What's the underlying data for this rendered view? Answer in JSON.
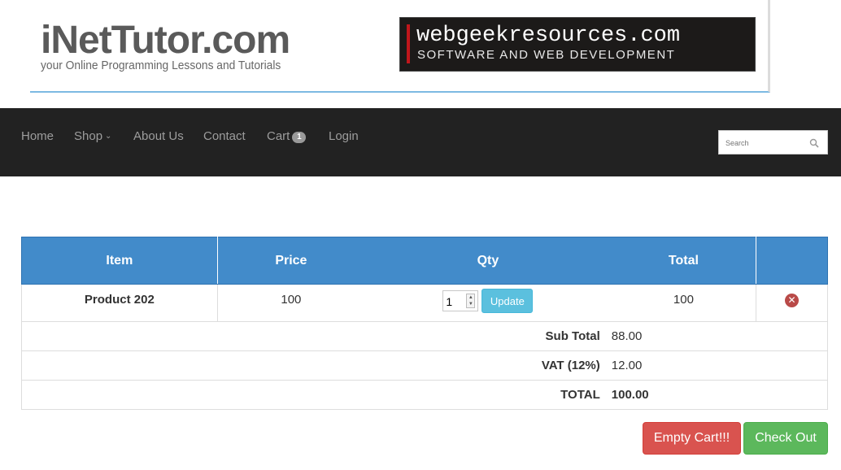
{
  "banner": {
    "logo_title": "iNetTutor.com",
    "logo_subtitle": "your Online Programming Lessons and Tutorials",
    "ad_line1": "webgeekresources.com",
    "ad_line2": "SOFTWARE AND WEB DEVELOPMENT"
  },
  "nav": {
    "home": "Home",
    "shop": "Shop",
    "about": "About Us",
    "contact": "Contact",
    "cart": "Cart",
    "cart_count": "1",
    "login": "Login",
    "search_placeholder": "Search"
  },
  "cart": {
    "headers": {
      "item": "Item",
      "price": "Price",
      "qty": "Qty",
      "total": "Total"
    },
    "rows": [
      {
        "item": "Product 202",
        "price": "100",
        "qty": "1",
        "total": "100"
      }
    ],
    "update_label": "Update",
    "subtotal_label": "Sub Total",
    "subtotal_value": "88.00",
    "vat_label": "VAT (12%)",
    "vat_value": "12.00",
    "total_label": "TOTAL",
    "total_value": "100.00"
  },
  "actions": {
    "empty_cart": "Empty Cart!!!",
    "checkout": "Check Out"
  },
  "colors": {
    "navbar_bg": "#222222",
    "table_header": "#428bca",
    "danger": "#d9534f",
    "success": "#5cb85c",
    "info": "#5bc0de"
  }
}
